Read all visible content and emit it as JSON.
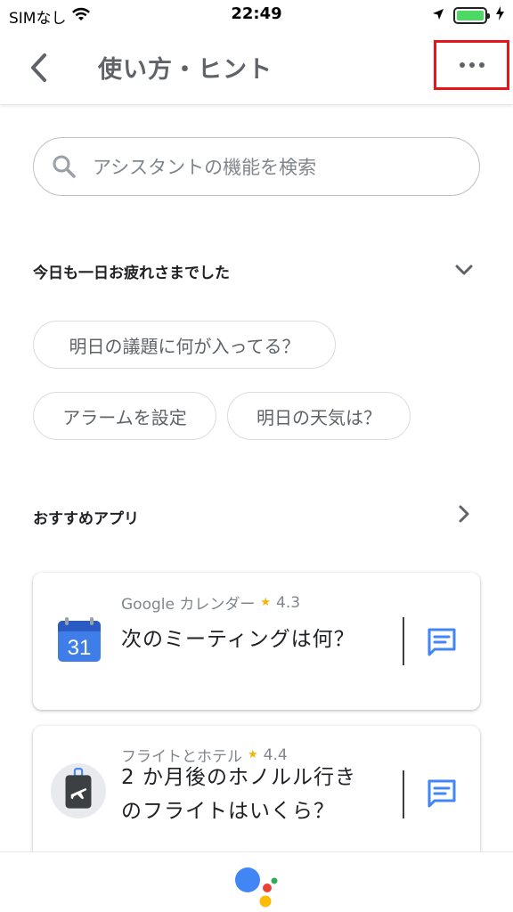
{
  "status_bar": {
    "carrier": "SIMなし",
    "time": "22:49"
  },
  "app_bar": {
    "title": "使い方・ヒント"
  },
  "search": {
    "placeholder": "アシスタントの機能を検索"
  },
  "greeting_section": {
    "title": "今日も一日お疲れさまでした",
    "chips": [
      "明日の議題に何が入ってる？",
      "アラームを設定",
      "明日の天気は？"
    ]
  },
  "recommended_section": {
    "title": "おすすめアプリ"
  },
  "cards": [
    {
      "app_name": "Google カレンダー",
      "rating": "4.3",
      "icon_text": "31",
      "query": "次のミーティングは何？"
    },
    {
      "app_name": "フライトとホテル",
      "rating": "4.4",
      "query_line1": "2 か月後のホノルル行き",
      "query_line2": "のフライトはいくら？"
    }
  ],
  "colors": {
    "accent_blue": "#4285f4",
    "assistant_red": "#ea4335",
    "assistant_yellow": "#fbbc05",
    "assistant_green": "#34a853",
    "highlight_red": "#e8141c",
    "battery_green": "#4cd964"
  }
}
